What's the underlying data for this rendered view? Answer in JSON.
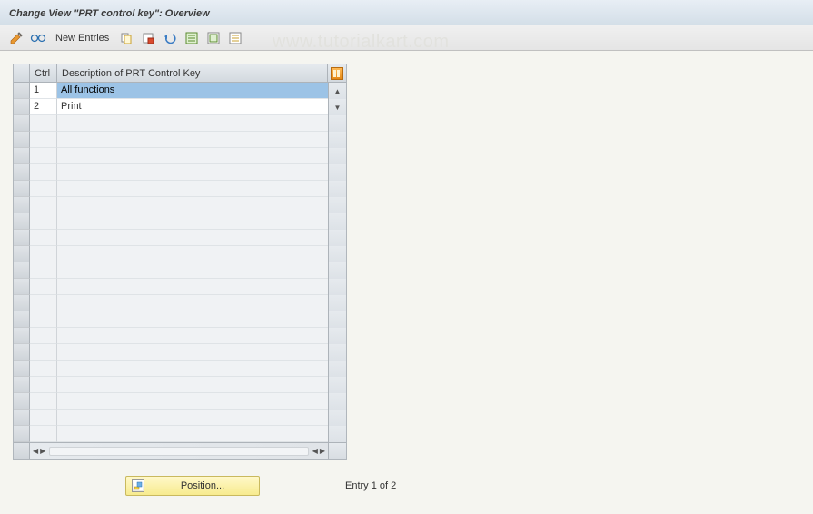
{
  "title": "Change View \"PRT control key\": Overview",
  "toolbar": {
    "new_entries_label": "New Entries"
  },
  "watermark": "www.tutorialkart.com",
  "table": {
    "headers": {
      "ctrl": "Ctrl",
      "desc": "Description of PRT Control Key"
    },
    "rows": [
      {
        "ctrl": "1",
        "desc": "All functions",
        "selected": true
      },
      {
        "ctrl": "2",
        "desc": "Print",
        "selected": false
      }
    ],
    "empty_rows": 20
  },
  "footer": {
    "position_label": "Position...",
    "entry_label": "Entry 1 of 2"
  },
  "icons": {
    "pencil": "pencil-toggle-icon",
    "glasses": "glasses-icon",
    "copy": "copy-icon",
    "save_red": "save-icon",
    "undo": "undo-icon",
    "select_all": "select-all-icon",
    "deselect": "deselect-all-icon",
    "config": "config-icon",
    "position": "position-icon"
  }
}
